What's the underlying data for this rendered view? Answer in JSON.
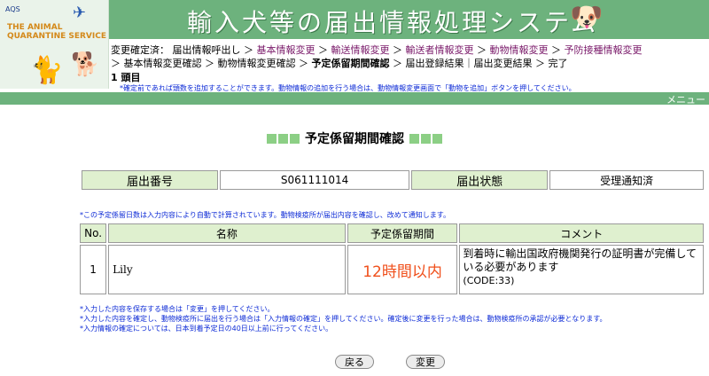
{
  "logo": {
    "tag": "AQS",
    "agency": "THE ANIMAL QUARANTINE SERVICE"
  },
  "header": {
    "title": "輸入犬等の届出情報処理システム"
  },
  "breadcrumb": {
    "prefix": "変更確定済：",
    "items": [
      "届出情報呼出し",
      "基本情報変更",
      "輸送情報変更",
      "輸送者情報変更",
      "動物情報変更",
      "予防接種情報変更",
      "基本情報変更確認",
      "動物情報変更確認",
      "予定係留期間確認",
      "届出登録結果｜届出変更結果",
      "完了"
    ],
    "separator": "＞"
  },
  "count_label": "1 頭目",
  "note_top": "*確定前であれば頭数を追加することができます。動物情報の追加を行う場合は、動物情報変更画面で「動物を追加」ボタンを押してください。",
  "menubar": {
    "label": "メニュー"
  },
  "page_heading": "予定係留期間確認",
  "summary": {
    "label_no": "届出番号",
    "value_no": "S061111014",
    "label_status": "届出状態",
    "value_status": "受理通知済"
  },
  "note_mid": "*この予定係留日数は入力内容により自動で計算されています。動物検疫所が届出内容を確認し、改めて通知します。",
  "detail_table": {
    "headers": [
      "No.",
      "名称",
      "予定係留期間",
      "コメント"
    ],
    "rows": [
      {
        "no": "1",
        "name": "Lily",
        "period": "12時間以内",
        "comment": "到着時に輸出国政府機関発行の証明書が完備している必要があります",
        "code": "(CODE:33)"
      }
    ]
  },
  "notes": [
    "*入力した内容を保存する場合は「変更」を押してください。",
    "*入力した内容を確定し、動物検疫所に届出を行う場合は「入力情報の確定」を押してください。確定後に変更を行った場合は、動物検疫所の承認が必要となります。",
    "*入力情報の確定については、日本到着予定日の40日以上前に行ってください。"
  ],
  "buttons": {
    "back": "戻る",
    "change": "変更"
  },
  "colors": {
    "banner": "#6db27d",
    "label_cell": "#dff0cf",
    "period_text": "#f0501c",
    "note_text": "#0d2bd6",
    "link": "#7a1a6a"
  }
}
